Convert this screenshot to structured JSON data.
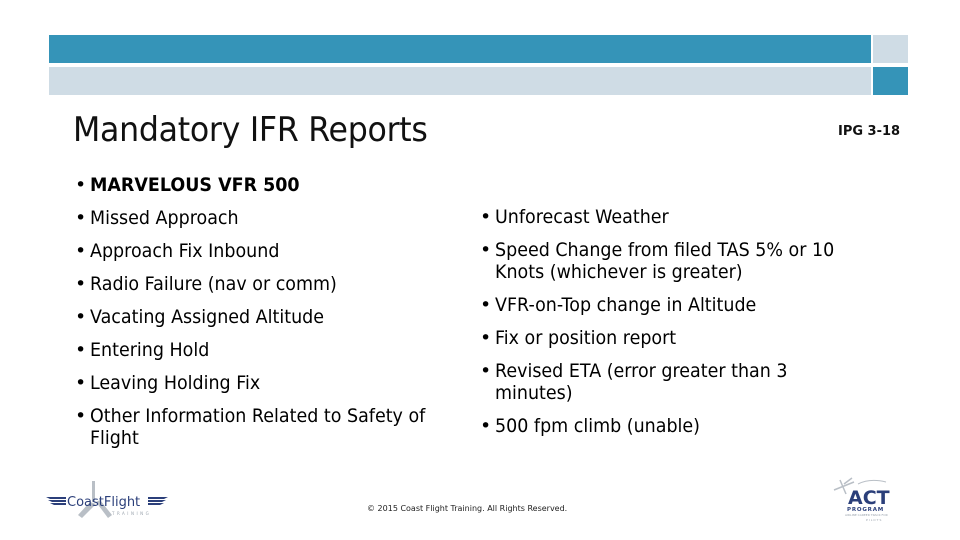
{
  "slide": {
    "title": "Mandatory IFR Reports",
    "reference": "IPG 3-18",
    "bullet_glyph": "•",
    "left_list": [
      {
        "text": "MARVELOUS VFR 500",
        "bold": true
      },
      {
        "text": "Missed Approach"
      },
      {
        "text": "Approach Fix Inbound"
      },
      {
        "text": "Radio Failure (nav or comm)"
      },
      {
        "text": "Vacating Assigned Altitude"
      },
      {
        "text": "Entering Hold"
      },
      {
        "text": "Leaving Holding Fix"
      },
      {
        "text": "Other Information Related to Safety of",
        "continuation": "Flight"
      }
    ],
    "right_list": [
      {
        "text": "Unforecast Weather"
      },
      {
        "text": "Speed Change from filed TAS 5% or 10",
        "continuation": "Knots (whichever is greater)"
      },
      {
        "text": "VFR-on-Top change in Altitude"
      },
      {
        "text": "Fix or position report"
      },
      {
        "text": "Revised ETA (error greater than 3",
        "continuation": "minutes)"
      },
      {
        "text": "500 fpm climb (unable)"
      }
    ],
    "footer": "© 2015 Coast Flight Training. All Rights Reserved."
  },
  "logos": {
    "left": {
      "name": "CoastFlight",
      "tagline": "TRAINING"
    },
    "right": {
      "name": "ACT",
      "line2": "PROGRAM",
      "line3": "AIRLINE CAREER TRACK FOR",
      "line4": "PILOTS"
    }
  },
  "colors": {
    "accent_blue": "#3594b8",
    "accent_light": "#cfdce5",
    "logo_navy": "#2b3f7a",
    "logo_gray": "#9aa3ad"
  }
}
